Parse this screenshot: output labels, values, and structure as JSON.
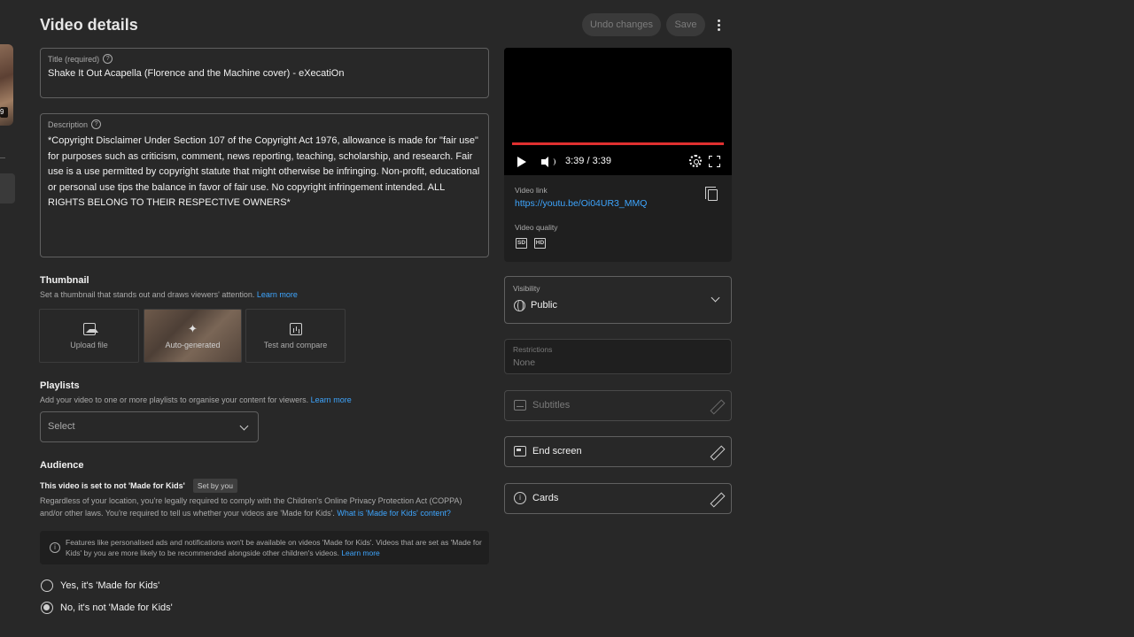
{
  "header": {
    "title": "Video details",
    "undo_label": "Undo changes",
    "save_label": "Save"
  },
  "rail": {
    "duration_badge": "9"
  },
  "title_field": {
    "label": "Title (required)",
    "value": "Shake It Out Acapella (Florence and the Machine cover) - eXecatiOn"
  },
  "description_field": {
    "label": "Description",
    "value": "*Copyright Disclaimer Under Section 107 of the Copyright Act 1976, allowance is made for \"fair use\" for purposes such as criticism, comment, news reporting, teaching, scholarship, and research. Fair use is a use permitted by copyright statute that might otherwise be infringing. Non-profit, educational or personal use tips the balance in favor of fair use. No copyright infringement intended. ALL RIGHTS BELONG TO THEIR RESPECTIVE OWNERS*"
  },
  "thumbnail": {
    "title": "Thumbnail",
    "subtitle": "Set a thumbnail that stands out and draws viewers' attention.",
    "learn_more": "Learn more",
    "options": [
      {
        "label": "Upload file",
        "icon": "image-upload-icon"
      },
      {
        "label": "Auto-generated",
        "icon": "sparkle-icon"
      },
      {
        "label": "Test and compare",
        "icon": "chart-icon"
      }
    ]
  },
  "playlists": {
    "title": "Playlists",
    "subtitle": "Add your video to one or more playlists to organise your content for viewers.",
    "learn_more": "Learn more",
    "select_value": "Select"
  },
  "audience": {
    "title": "Audience",
    "status": "This video is set to not 'Made for Kids'",
    "badge": "Set by you",
    "coppa_text": "Regardless of your location, you're legally required to comply with the Children's Online Privacy Protection Act (COPPA) and/or other laws. You're required to tell us whether your videos are 'Made for Kids'.",
    "coppa_link": "What is 'Made for Kids' content?",
    "info_text": "Features like personalised ads and notifications won't be available on videos 'Made for Kids'. Videos that are set as 'Made for Kids' by you are more likely to be recommended alongside other children's videos.",
    "info_link": "Learn more",
    "options": [
      {
        "label": "Yes, it's 'Made for Kids'",
        "selected": false
      },
      {
        "label": "No, it's not 'Made for Kids'",
        "selected": true
      }
    ]
  },
  "preview": {
    "time": "3:39 / 3:39",
    "progress": 1.0,
    "video_link_label": "Video link",
    "video_link": "https://youtu.be/Oi04UR3_MMQ",
    "quality_label": "Video quality",
    "quality_badges": [
      "SD",
      "HD"
    ]
  },
  "visibility": {
    "label": "Visibility",
    "value": "Public"
  },
  "restrictions": {
    "label": "Restrictions",
    "value": "None"
  },
  "actions": {
    "subtitles": "Subtitles",
    "end_screen": "End screen",
    "cards": "Cards"
  },
  "colors": {
    "background": "#282828",
    "link": "#3ea6ff",
    "progress": "#e03030"
  }
}
